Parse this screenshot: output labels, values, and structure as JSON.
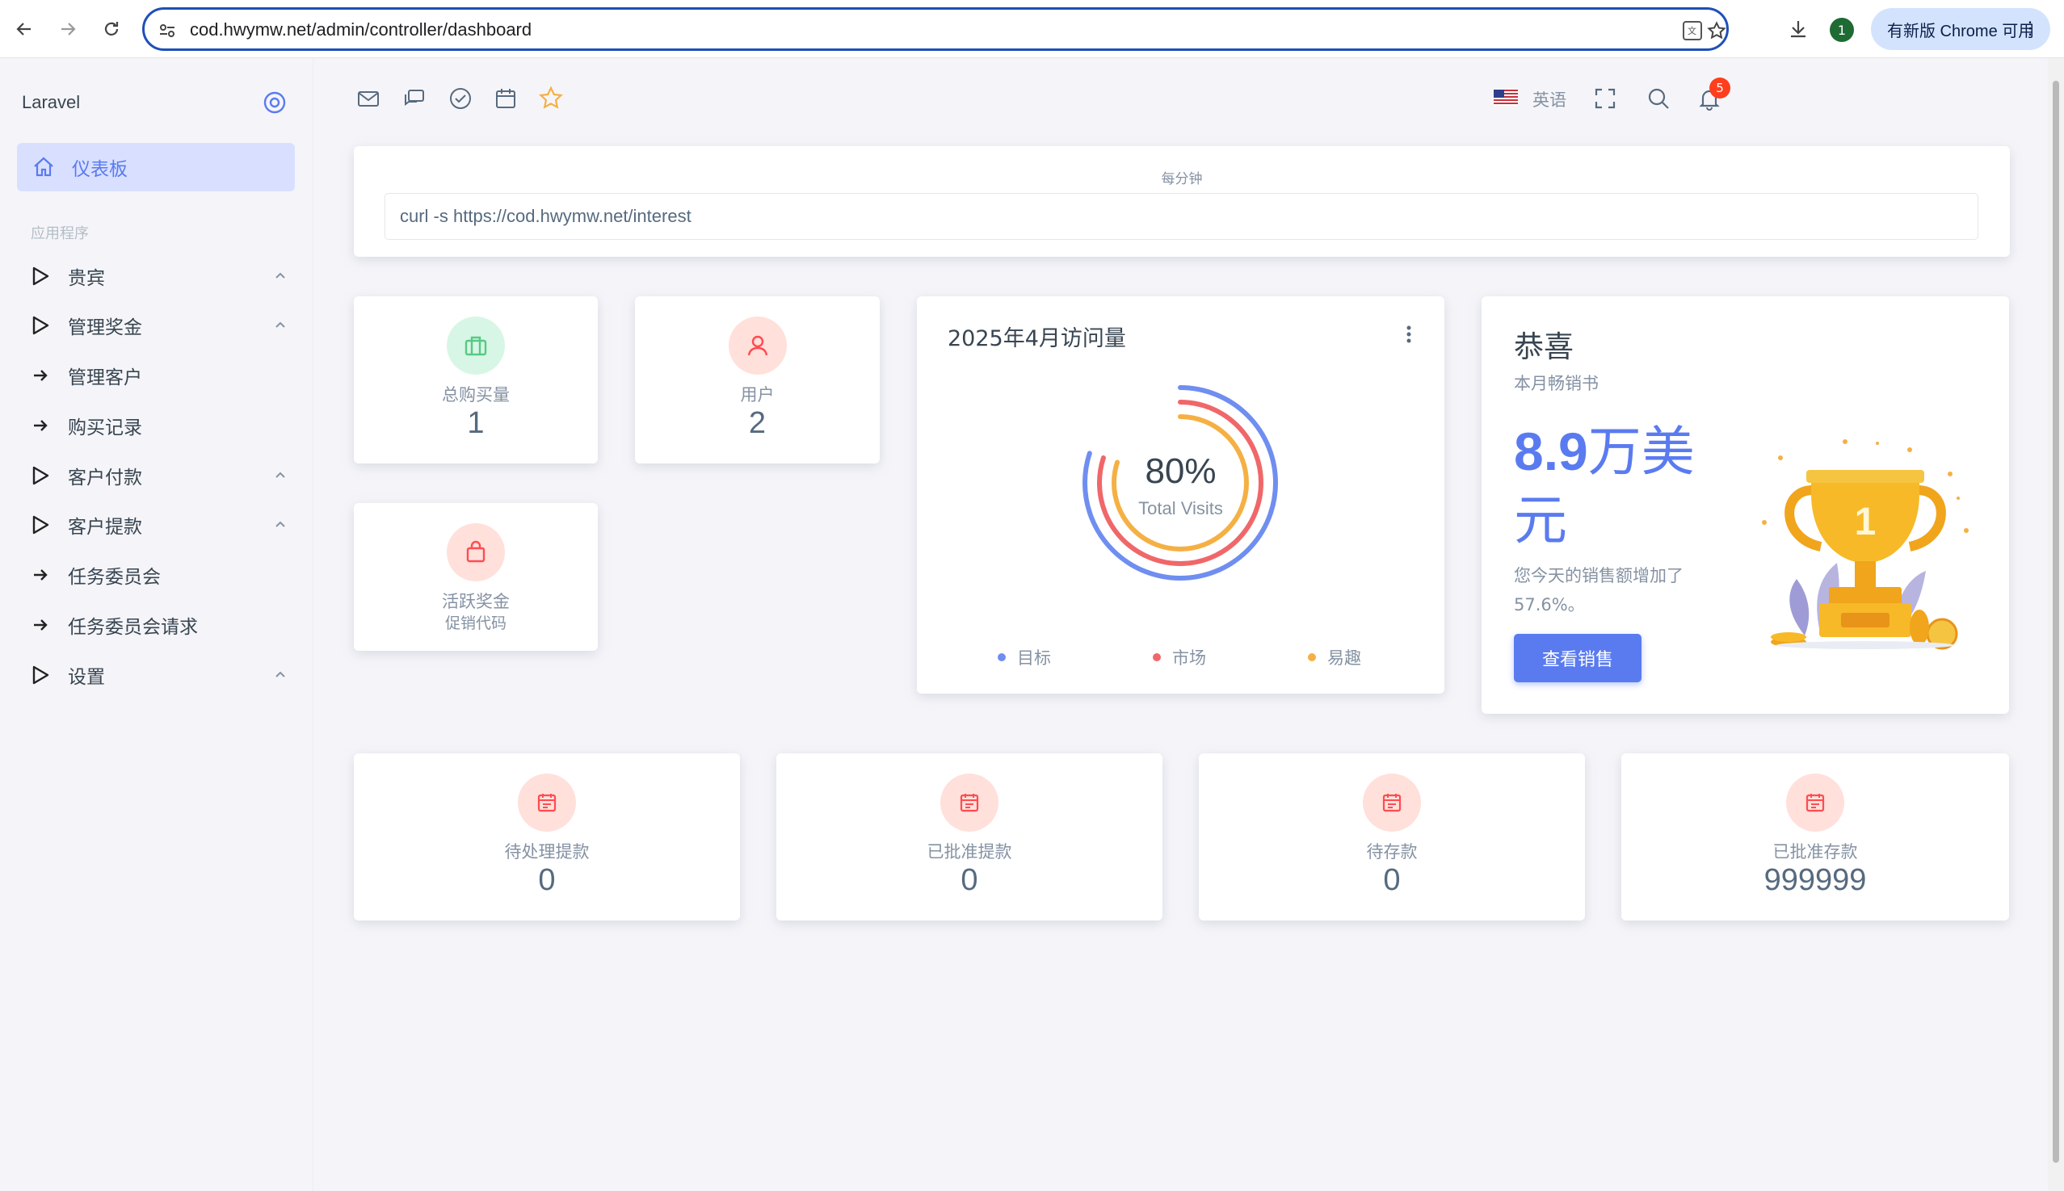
{
  "browser": {
    "url": "cod.hwymw.net/admin/controller/dashboard",
    "profile_initial": "1",
    "update_label": "有新版 Chrome 可用"
  },
  "sidebar": {
    "brand": "Laravel",
    "active_item": "仪表板",
    "section_header": "应用程序",
    "items": [
      {
        "label": "贵宾",
        "type": "group"
      },
      {
        "label": "管理奖金",
        "type": "group"
      },
      {
        "label": "管理客户",
        "type": "link"
      },
      {
        "label": "购买记录",
        "type": "link"
      },
      {
        "label": "客户付款",
        "type": "group"
      },
      {
        "label": "客户提款",
        "type": "group"
      },
      {
        "label": "任务委员会",
        "type": "link"
      },
      {
        "label": "任务委员会请求",
        "type": "link"
      },
      {
        "label": "设置",
        "type": "group"
      }
    ]
  },
  "navbar": {
    "language": "英语",
    "notification_count": "5"
  },
  "cron": {
    "label": "每分钟",
    "command": "curl -s https://cod.hwymw.net/interest"
  },
  "stats": {
    "total_purchase": {
      "label": "总购买量",
      "value": "1"
    },
    "users": {
      "label": "用户",
      "value": "2"
    },
    "active_bonus": {
      "label": "活跃奖金",
      "sublabel": "促销代码"
    }
  },
  "visits": {
    "title": "2025年4月访问量",
    "percent": "80%",
    "subtitle": "Total Visits",
    "legend": [
      {
        "label": "目标",
        "color": "#6f8ef0"
      },
      {
        "label": "市场",
        "color": "#f0676a"
      },
      {
        "label": "易趣",
        "color": "#f5b044"
      }
    ],
    "ring_fractions": [
      0.8,
      0.8,
      0.8
    ]
  },
  "congrats": {
    "title": "恭喜",
    "subtitle": "本月畅销书",
    "amount_number": "8.9",
    "amount_unit": "万美元",
    "description": "您今天的销售额增加了57.6%。",
    "button": "查看销售"
  },
  "bottom_stats": [
    {
      "label": "待处理提款",
      "value": "0"
    },
    {
      "label": "已批准提款",
      "value": "0"
    },
    {
      "label": "待存款",
      "value": "0"
    },
    {
      "label": "已批准存款",
      "value": "999999"
    }
  ],
  "colors": {
    "primary": "#5a7bf0",
    "success_bg": "#d8f6e5",
    "success": "#56ca85",
    "danger_bg": "#ffe0db",
    "danger": "#ff4c51"
  }
}
